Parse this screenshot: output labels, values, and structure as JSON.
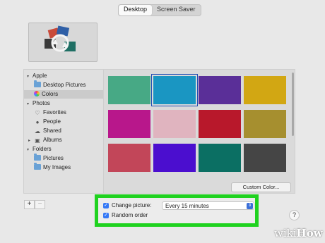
{
  "tabs": [
    {
      "label": "Desktop",
      "selected": true
    },
    {
      "label": "Screen Saver",
      "selected": false
    }
  ],
  "sidebar": {
    "sections": [
      {
        "label": "Apple",
        "expanded": true,
        "items": [
          {
            "label": "Desktop Pictures",
            "icon": "folder-icon",
            "selected": false
          },
          {
            "label": "Colors",
            "icon": "color-wheel-icon",
            "selected": true
          }
        ]
      },
      {
        "label": "Photos",
        "expanded": true,
        "items": [
          {
            "label": "Favorites",
            "icon": "heart-icon",
            "selected": false
          },
          {
            "label": "People",
            "icon": "person-icon",
            "selected": false
          },
          {
            "label": "Shared",
            "icon": "cloud-icon",
            "selected": false
          },
          {
            "label": "Albums",
            "icon": "albums-icon",
            "selected": false
          }
        ]
      },
      {
        "label": "Folders",
        "expanded": true,
        "items": [
          {
            "label": "Pictures",
            "icon": "folder-icon",
            "selected": false
          },
          {
            "label": "My Images",
            "icon": "folder-icon",
            "selected": false
          }
        ]
      }
    ],
    "add_label": "+",
    "remove_label": "−"
  },
  "colors": {
    "swatches": [
      "#47a985",
      "#1a96c2",
      "#5a2f98",
      "#d2a713",
      "#b8178b",
      "#e0b4bf",
      "#b8182b",
      "#a68f2f",
      "#c24659",
      "#4b0ecf",
      "#0b6f63",
      "#454545"
    ],
    "selected_index": 1,
    "custom_button": "Custom Color..."
  },
  "options": {
    "change_picture_label": "Change picture:",
    "change_picture_checked": true,
    "interval_value": "Every 15 minutes",
    "random_order_label": "Random order",
    "random_order_checked": true,
    "highlight_color": "#1fd21f"
  },
  "help_label": "?",
  "watermark": {
    "prefix": "wiki",
    "suffix": "How"
  }
}
